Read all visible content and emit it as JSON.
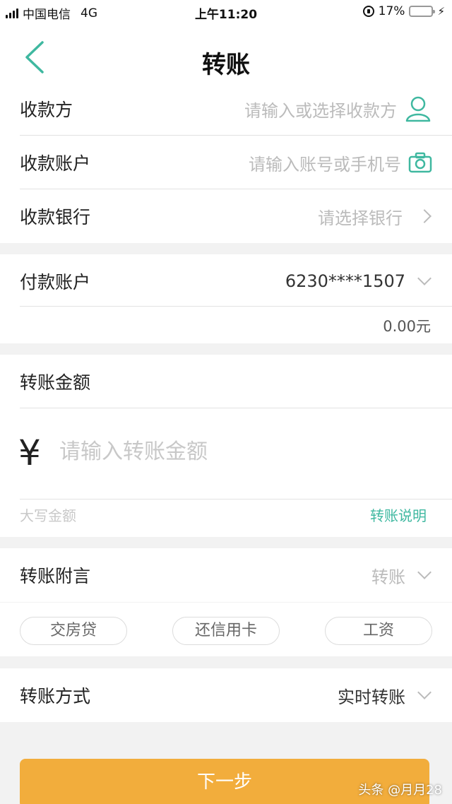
{
  "status_bar": {
    "carrier": "中国电信",
    "network": "4G",
    "time": "上午11:20",
    "battery_percent": "17%",
    "battery_level": 0.17
  },
  "nav": {
    "title": "转账",
    "icons": {
      "back": "chevron-left-icon"
    }
  },
  "payee": {
    "payee_label": "收款方",
    "payee_placeholder": "请输入或选择收款方",
    "account_label": "收款账户",
    "account_placeholder": "请输入账号或手机号",
    "bank_label": "收款银行",
    "bank_placeholder": "请选择银行",
    "icons": {
      "contact": "person-icon",
      "scan": "camera-icon"
    }
  },
  "payer": {
    "label": "付款账户",
    "account": "6230****1507",
    "balance": "0.00元"
  },
  "amount": {
    "label": "转账金额",
    "currency_symbol": "¥",
    "placeholder": "请输入转账金额",
    "uppercase_label": "大写金额",
    "help_link": "转账说明"
  },
  "remark": {
    "label": "转账附言",
    "value": "转账",
    "chips": [
      "交房贷",
      "还信用卡",
      "工资"
    ]
  },
  "method": {
    "label": "转账方式",
    "value": "实时转账"
  },
  "next_button": "下一步",
  "watermark": "头条 @月月28",
  "colors": {
    "accent": "#3fb8a0",
    "button": "#f2ad3c",
    "placeholder": "#bbbbbb",
    "background": "#f2f2f2"
  }
}
